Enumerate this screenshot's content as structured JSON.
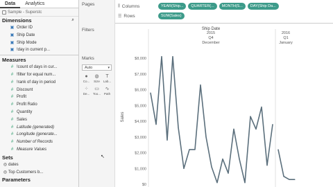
{
  "left_panel": {
    "tabs": [
      "Data",
      "Analytics"
    ],
    "datasource": "Sample - Superstc",
    "dimensions_title": "Dimensions",
    "dimensions": [
      "Order ID",
      "Ship Date",
      "Ship Mode",
      "!day in current p..."
    ],
    "measures_title": "Measures",
    "measures": [
      "!count of days in cur...",
      "!filter for equal num...",
      "!rank of day in period",
      "Discount",
      "Profit",
      "Profit Ratio",
      "Quantity",
      "Sales",
      "Latitude (generated)",
      "Longitude (generate...",
      "Number of Records",
      "Measure Values"
    ],
    "sets_title": "Sets",
    "sets": [
      "dates",
      "Top Customers b..."
    ],
    "parameters_title": "Parameters"
  },
  "cards": {
    "pages": "Pages",
    "filters": "Filters",
    "marks": "Marks",
    "mark_type": "Auto",
    "mark_buttons": [
      "Co...",
      "Size",
      "Lab...",
      "De...",
      "Too...",
      "Path"
    ]
  },
  "shelves": {
    "columns_label": "Columns",
    "columns_pills": [
      "YEAR(Ship...",
      "QUARTER(...",
      "MONTH(S...",
      "DAY(Ship Da..."
    ],
    "rows_label": "Rows",
    "rows_pills": [
      "SUM(Sales)"
    ]
  },
  "chart_data": {
    "type": "line",
    "header_top": "Ship Date",
    "panes": [
      {
        "year": "2015",
        "quarter": "Q4",
        "month": "December"
      },
      {
        "year": "2016",
        "quarter": "Q1",
        "month": "January"
      }
    ],
    "ylabel": "Sales",
    "ylim": [
      0,
      8000
    ],
    "yticks": [
      "$0",
      "$1,000",
      "$2,000",
      "$3,000",
      "$4,000",
      "$5,000",
      "$6,000",
      "$7,000",
      "$8,000"
    ],
    "series": [
      {
        "values": [
          5800,
          3800,
          8100,
          2800,
          8100,
          3600,
          1000,
          2200,
          2200,
          6300,
          3000,
          1100,
          100,
          1600,
          700,
          3500,
          1600,
          100,
          4300,
          3500,
          4900,
          1200,
          3800
        ]
      },
      {
        "values": [
          2200,
          500,
          300,
          300
        ]
      }
    ],
    "line_color": "#5b6f7c"
  }
}
